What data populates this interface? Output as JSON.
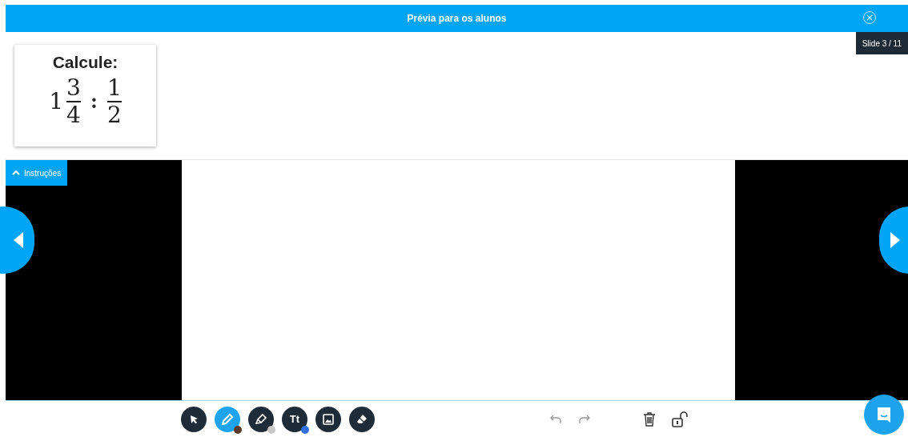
{
  "header": {
    "title": "Prévia para os alunos"
  },
  "slide_counter": "Slide 3 / 11",
  "card": {
    "title": "Calcule:",
    "whole": "1",
    "numerator": "3",
    "denominator": "4",
    "operator": ":",
    "numerator_2": "1",
    "denominator_2": "2"
  },
  "instructions": {
    "label": "Instruções",
    "expanded": false
  },
  "tools": [
    {
      "kind": "select",
      "selected": false
    },
    {
      "kind": "pen",
      "selected": true,
      "color": "#5a3a2a"
    },
    {
      "kind": "highlighter",
      "selected": false,
      "color": "#c8c8c8"
    },
    {
      "kind": "text",
      "label": "Tt",
      "selected": false,
      "color": "#2f6fe0"
    },
    {
      "kind": "image",
      "selected": false
    },
    {
      "kind": "eraser",
      "selected": false
    }
  ]
}
